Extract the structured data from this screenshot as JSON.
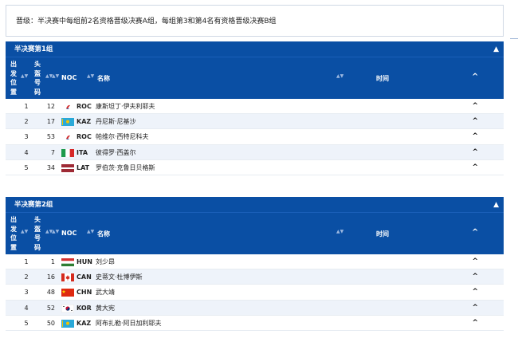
{
  "notice": "晋级：半决赛中每组前2名资格晋级决赛A组，每组第3和第4名有资格晋级决赛B组",
  "headers": {
    "pos": [
      "出",
      "发",
      "位",
      "置"
    ],
    "bib": [
      "头",
      "盔",
      "号",
      "码"
    ],
    "noc": "NOC",
    "name": "名称",
    "time": "时间"
  },
  "icons": {
    "caret": "▲",
    "sort": "▲▼",
    "expand": "^"
  },
  "groups": [
    {
      "title": "半决赛第1组",
      "rows": [
        {
          "pos": "1",
          "bib": "12",
          "noc": "ROC",
          "flag": "roc",
          "name": "康斯坦丁·伊夫利耶夫"
        },
        {
          "pos": "2",
          "bib": "17",
          "noc": "KAZ",
          "flag": "kaz",
          "name": "丹尼斯·尼基沙"
        },
        {
          "pos": "3",
          "bib": "53",
          "noc": "ROC",
          "flag": "roc",
          "name": "帕维尔·西特尼科夫"
        },
        {
          "pos": "4",
          "bib": "7",
          "noc": "ITA",
          "flag": "ita",
          "name": "彼得罗·西盖尔"
        },
        {
          "pos": "5",
          "bib": "34",
          "noc": "LAT",
          "flag": "lat",
          "name": "罗伯茨·克鲁日贝格斯"
        }
      ]
    },
    {
      "title": "半决赛第2组",
      "rows": [
        {
          "pos": "1",
          "bib": "1",
          "noc": "HUN",
          "flag": "hun",
          "name": "刘少昂"
        },
        {
          "pos": "2",
          "bib": "16",
          "noc": "CAN",
          "flag": "can",
          "name": "史蒂文·杜博伊斯"
        },
        {
          "pos": "3",
          "bib": "48",
          "noc": "CHN",
          "flag": "chn",
          "name": "武大靖"
        },
        {
          "pos": "4",
          "bib": "52",
          "noc": "KOR",
          "flag": "kor",
          "name": "黄大宪"
        },
        {
          "pos": "5",
          "bib": "50",
          "noc": "KAZ",
          "flag": "kaz",
          "name": "阿布扎勒·阿日加利耶夫"
        }
      ]
    }
  ]
}
